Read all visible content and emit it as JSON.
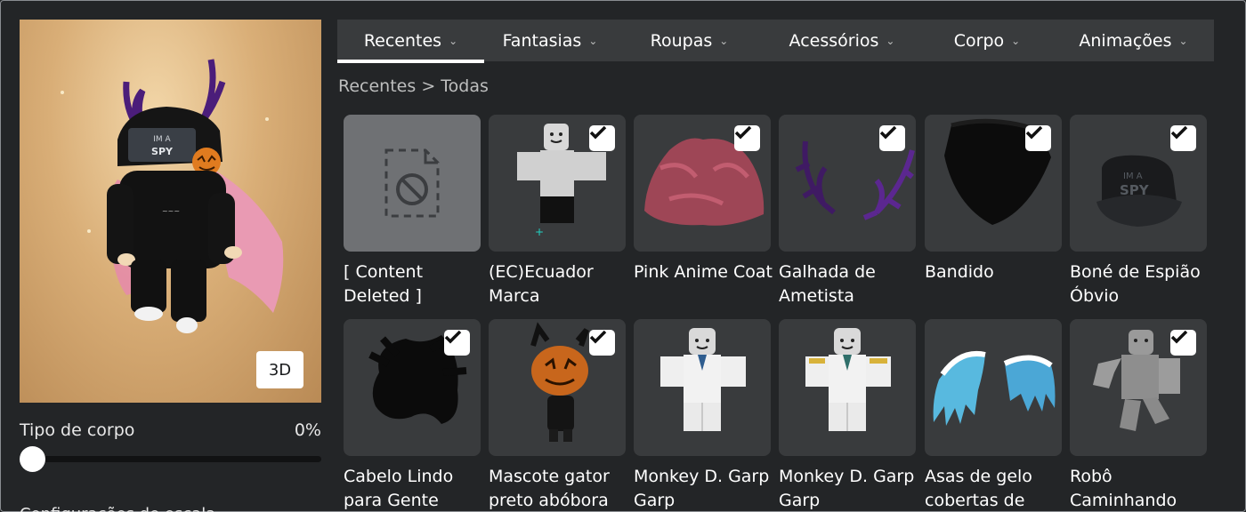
{
  "tabs": [
    {
      "label": "Recentes",
      "active": true
    },
    {
      "label": "Fantasias",
      "active": false
    },
    {
      "label": "Roupas",
      "active": false
    },
    {
      "label": "Acessórios",
      "active": false
    },
    {
      "label": "Corpo",
      "active": false
    },
    {
      "label": "Animações",
      "active": false
    }
  ],
  "breadcrumb": {
    "parent": "Recentes",
    "separator": ">",
    "current": "Todas"
  },
  "avatar": {
    "view_button": "3D",
    "hat_text": "IM A\nSPY"
  },
  "body_type": {
    "label": "Tipo de corpo",
    "value": "0%",
    "level": 0
  },
  "cut_text": "Configurações de escala",
  "items": [
    {
      "name": "[ Content Deleted ]",
      "checked": false,
      "icon": "content-deleted-icon"
    },
    {
      "name": "(EC)Ecuador Marca",
      "checked": true,
      "icon": "shirt-thumbnail"
    },
    {
      "name": "Pink Anime Coat",
      "checked": true,
      "icon": "coat-thumbnail"
    },
    {
      "name": "Galhada de Ametista",
      "checked": true,
      "icon": "antlers-thumbnail"
    },
    {
      "name": "Bandido",
      "checked": true,
      "icon": "bandana-thumbnail"
    },
    {
      "name": "Boné de Espião Óbvio",
      "checked": true,
      "icon": "cap-thumbnail"
    },
    {
      "name": "Cabelo Lindo para Gente",
      "checked": true,
      "icon": "hair-thumbnail"
    },
    {
      "name": "Mascote gator preto abóbora",
      "checked": true,
      "icon": "pumpkin-thumbnail"
    },
    {
      "name": "Monkey D. Garp Garp",
      "checked": false,
      "icon": "uniform-thumbnail"
    },
    {
      "name": "Monkey D. Garp Garp",
      "checked": false,
      "icon": "uniform-thumbnail"
    },
    {
      "name": "Asas de gelo cobertas de",
      "checked": false,
      "icon": "wings-thumbnail"
    },
    {
      "name": "Robô Caminhando",
      "checked": true,
      "icon": "robot-thumbnail"
    }
  ],
  "colors": {
    "background": "#232527",
    "tab_bar": "#393b3d",
    "card": "#393b3d",
    "deleted_card": "#6f7174"
  }
}
